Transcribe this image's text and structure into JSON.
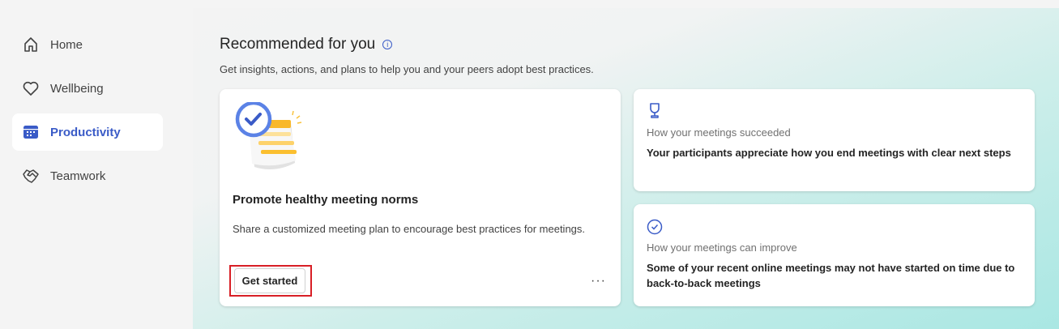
{
  "sidebar": {
    "items": [
      {
        "label": "Home",
        "icon": "home-icon"
      },
      {
        "label": "Wellbeing",
        "icon": "heart-icon"
      },
      {
        "label": "Productivity",
        "icon": "calendar-icon",
        "active": true
      },
      {
        "label": "Teamwork",
        "icon": "handshake-icon"
      }
    ]
  },
  "main": {
    "title": "Recommended for you",
    "info_icon": "i",
    "subtitle": "Get insights, actions, and plans to help you and your peers adopt best practices.",
    "feature_card": {
      "title": "Promote healthy meeting norms",
      "description": "Share a customized meeting plan to encourage best practices for meetings.",
      "button": "Get started",
      "more": "···"
    },
    "insights": [
      {
        "icon": "trophy-icon",
        "label": "How your meetings succeeded",
        "text": "Your participants appreciate how you end meetings with clear next steps"
      },
      {
        "icon": "check-circle-icon",
        "label": "How your meetings can improve",
        "text": "Some of your recent online meetings may not have started on time due to back-to-back meetings"
      }
    ]
  },
  "colors": {
    "accent": "#3a5bc7",
    "highlight": "#d81f26"
  }
}
